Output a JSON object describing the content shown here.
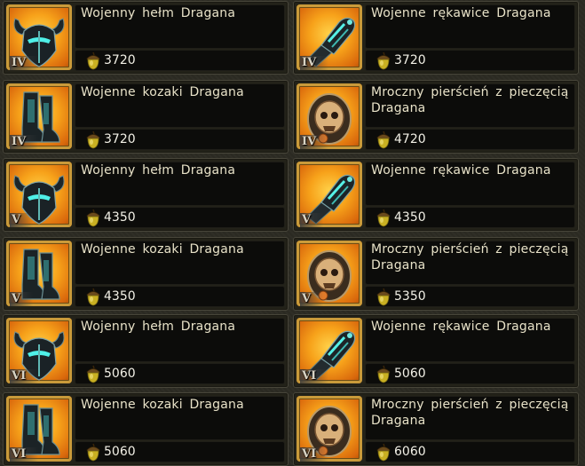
{
  "items": [
    {
      "name": "Wojenny hełm Dragana",
      "price": "3720",
      "tier": "IV",
      "icon": "helmet-icon"
    },
    {
      "name": "Wojenne rękawice Dragana",
      "price": "3720",
      "tier": "IV",
      "icon": "gauntlet-icon"
    },
    {
      "name": "Wojenne kozaki Dragana",
      "price": "3720",
      "tier": "IV",
      "icon": "boots-icon"
    },
    {
      "name": "Mroczny pierścień z pieczęcią Dragana",
      "price": "4720",
      "tier": "IV",
      "icon": "skull-ring-icon"
    },
    {
      "name": "Wojenny hełm Dragana",
      "price": "4350",
      "tier": "V",
      "icon": "helmet-icon"
    },
    {
      "name": "Wojenne rękawice Dragana",
      "price": "4350",
      "tier": "V",
      "icon": "gauntlet-icon"
    },
    {
      "name": "Wojenne kozaki Dragana",
      "price": "4350",
      "tier": "V",
      "icon": "boots-icon"
    },
    {
      "name": "Mroczny pierścień z pieczęcią Dragana",
      "price": "5350",
      "tier": "V",
      "icon": "skull-ring-icon"
    },
    {
      "name": "Wojenny hełm Dragana",
      "price": "5060",
      "tier": "VI",
      "icon": "helmet-icon"
    },
    {
      "name": "Wojenne rękawice Dragana",
      "price": "5060",
      "tier": "VI",
      "icon": "gauntlet-icon"
    },
    {
      "name": "Wojenne kozaki Dragana",
      "price": "5060",
      "tier": "VI",
      "icon": "boots-icon"
    },
    {
      "name": "Mroczny pierścień z pieczęcią Dragana",
      "price": "6060",
      "tier": "VI",
      "icon": "skull-ring-icon"
    }
  ],
  "currency_icon": "acorn-icon",
  "colors": {
    "frame_gold": "#f7a21a",
    "text": "#e8e2c8",
    "panel": "#0c0c0a"
  }
}
